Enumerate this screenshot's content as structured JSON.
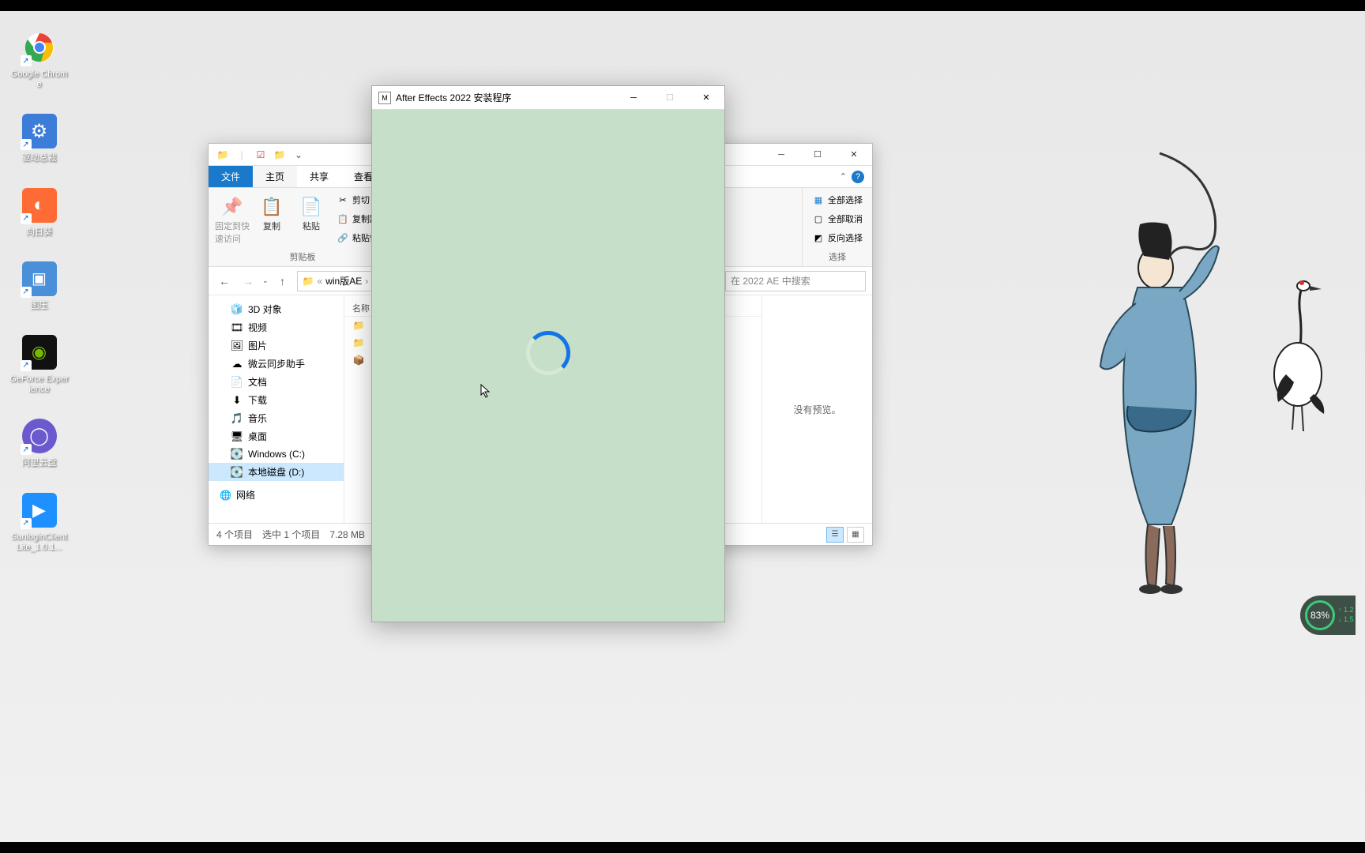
{
  "desktop_icons": [
    {
      "id": "chrome",
      "label": "Google Chrome",
      "color": "#fff"
    },
    {
      "id": "driver",
      "label": "驱动总裁",
      "color": "#3b7dd8"
    },
    {
      "id": "xiangrikui",
      "label": "向日葵",
      "color": "#ff6b35"
    },
    {
      "id": "tuya",
      "label": "图压",
      "color": "#4a90d9"
    },
    {
      "id": "geforce",
      "label": "GeForce Experience",
      "color": "#76b900"
    },
    {
      "id": "aliyun",
      "label": "阿里云盘",
      "color": "#6a5acd"
    },
    {
      "id": "sunlogin",
      "label": "SunloginClientLite_1.0.1...",
      "color": "#1e90ff"
    }
  ],
  "widget": {
    "percent": "83%",
    "up": "↑ 1.2",
    "down": "↓ 1.5"
  },
  "explorer": {
    "tabs": {
      "file": "文件",
      "home": "主页",
      "share": "共享",
      "view": "查看"
    },
    "ribbon": {
      "pin": "固定到快速访问",
      "copy": "复制",
      "paste": "粘贴",
      "cut": "剪切",
      "copypath": "复制路径",
      "pasteshortcut": "粘贴快捷",
      "clipboard_group": "剪贴板",
      "selectall": "全部选择",
      "selectnone": "全部取消",
      "invert": "反向选择",
      "select_group": "选择"
    },
    "nav": {
      "breadcrumb_prefix": "«",
      "breadcrumb": "win版AE",
      "search_placeholder": "在 2022 AE 中搜索"
    },
    "sidebar": [
      {
        "icon": "🧊",
        "label": "3D 对象",
        "sel": false
      },
      {
        "icon": "🎞",
        "label": "视频",
        "sel": false
      },
      {
        "icon": "🖼",
        "label": "图片",
        "sel": false
      },
      {
        "icon": "☁",
        "label": "微云同步助手",
        "sel": false
      },
      {
        "icon": "📄",
        "label": "文档",
        "sel": false
      },
      {
        "icon": "⬇",
        "label": "下载",
        "sel": false
      },
      {
        "icon": "🎵",
        "label": "音乐",
        "sel": false
      },
      {
        "icon": "🖥",
        "label": "桌面",
        "sel": false
      },
      {
        "icon": "💽",
        "label": "Windows (C:)",
        "sel": false
      },
      {
        "icon": "💽",
        "label": "本地磁盘 (D:)",
        "sel": true
      }
    ],
    "network_label": "网络",
    "col_name": "名称",
    "files": [
      {
        "icon": "📁"
      },
      {
        "icon": "📁"
      },
      {
        "icon": "📦"
      }
    ],
    "preview": "没有预览。",
    "status": {
      "items": "4 个项目",
      "selected": "选中 1 个项目",
      "size": "7.28 MB"
    }
  },
  "installer": {
    "title": "After Effects 2022 安装程序"
  }
}
